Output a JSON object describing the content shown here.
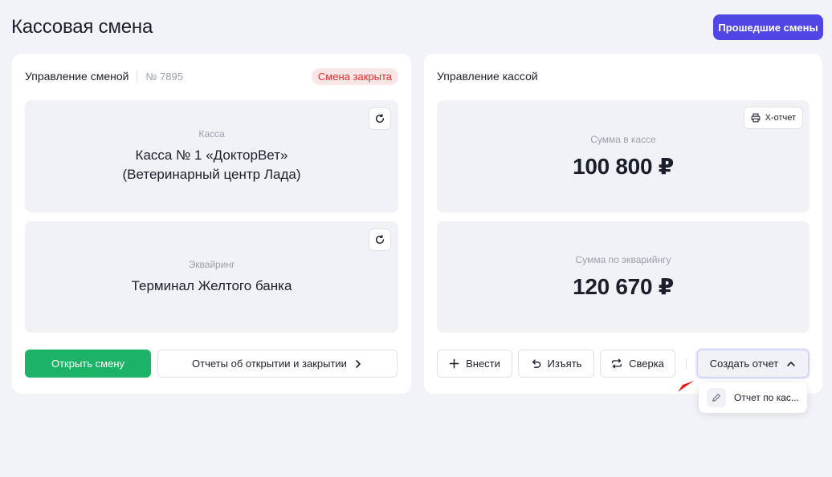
{
  "page": {
    "title": "Кассовая смена"
  },
  "header": {
    "past_shifts_label": "Прошедшие смены"
  },
  "shift": {
    "title": "Управление сменой",
    "number": "№ 7895",
    "status": "Смена закрыта",
    "register": {
      "label": "Касса",
      "value_line1": "Касса № 1 «ДокторВет»",
      "value_line2": "(Ветеринарный центр Лада)"
    },
    "acquiring": {
      "label": "Эквайринг",
      "value": "Терминал Желтого банка"
    },
    "open_label": "Открыть смену",
    "reports_label": "Отчеты об открытии и закрытии"
  },
  "cash": {
    "title": "Управление кассой",
    "xreport_label": "Х-отчет",
    "cash_sum": {
      "label": "Сумма в кассе",
      "value": "100 800 ₽"
    },
    "acquiring_sum": {
      "label": "Сумма по экварийнгу",
      "value": "120 670 ₽"
    },
    "actions": {
      "deposit": "Внести",
      "withdraw": "Изъять",
      "reconcile": "Сверка",
      "create_report": "Создать отчет"
    },
    "dropdown": {
      "item1": "Отчет по кас..."
    }
  },
  "colors": {
    "primary": "#4f46e5",
    "success": "#1db366",
    "danger": "#e02b2b",
    "background": "#f2f3f7"
  },
  "icons": [
    "refresh-icon",
    "printer-icon",
    "plus-icon",
    "undo-icon",
    "swap-icon",
    "chevron-right-icon",
    "chevron-up-icon",
    "pencil-icon"
  ]
}
